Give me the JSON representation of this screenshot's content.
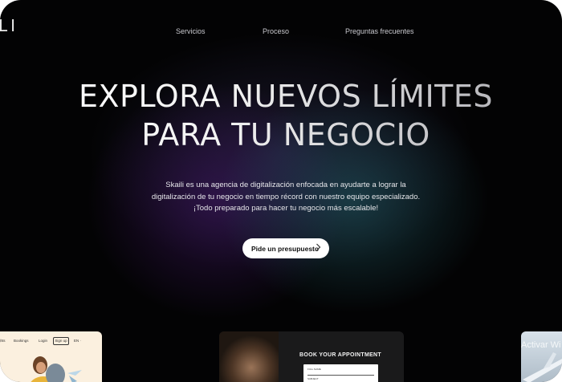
{
  "brand": {
    "logo_text": "LI"
  },
  "nav": {
    "items": [
      {
        "label": "Servicios"
      },
      {
        "label": "Proceso"
      },
      {
        "label": "Preguntas frecuentes"
      }
    ]
  },
  "hero": {
    "title_line1": "EXPLORA NUEVOS LÍMITES",
    "title_line2": "PARA TU NEGOCIO",
    "description_line1": "Skaili es una agencia de digitalización enfocada en ayudarte a lograr la",
    "description_line2": "digitalización de tu negocio en tiempo récord con nuestro equipo especializado.",
    "description_line3": "¡Todo preparado para hacer tu negocio más escalable!",
    "cta_label": "Pide un presupuesto",
    "cta_icon": "chevron-right-icon"
  },
  "previews": {
    "left": {
      "nav": [
        "ghts",
        "Bookings",
        "Login"
      ],
      "signup_label": "Sign up",
      "lang_label": "EN ·"
    },
    "middle": {
      "title": "BOOK YOUR APPOINTMENT",
      "field1_label": "FULL NAME",
      "field2_label": "SUBJECT"
    },
    "right": {
      "text": "Activar Wi"
    }
  },
  "colors": {
    "background": "#030304",
    "cta_background": "#ffffff",
    "text_light": "#e6e6ea"
  }
}
